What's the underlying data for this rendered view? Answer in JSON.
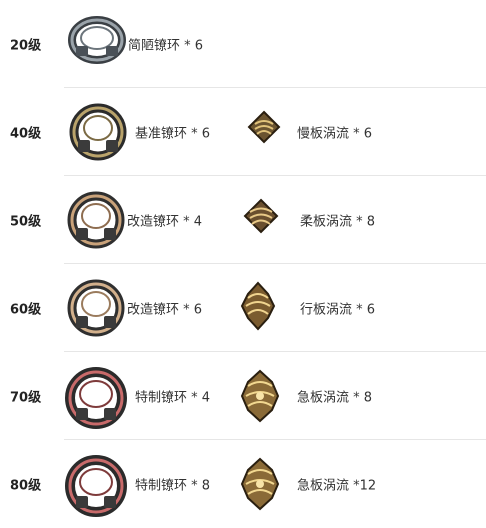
{
  "rows": [
    {
      "level": "20级",
      "ring_label": "简陋镣环 * 6",
      "ring_style": "plain",
      "vortex_label": "",
      "vortex_style": ""
    },
    {
      "level": "40级",
      "ring_label": "基准镣环 * 6",
      "ring_style": "gold",
      "vortex_label": "慢板涡流 * 6",
      "vortex_style": "flat"
    },
    {
      "level": "50级",
      "ring_label": "改造镣环 * 4",
      "ring_style": "copper",
      "vortex_label": "柔板涡流 * 8",
      "vortex_style": "flat"
    },
    {
      "level": "60级",
      "ring_label": "改造镣环 * 6",
      "ring_style": "copper",
      "vortex_label": "行板涡流 * 6",
      "vortex_style": "spiral"
    },
    {
      "level": "70级",
      "ring_label": "特制镣环 * 4",
      "ring_style": "red",
      "vortex_label": "急板涡流 * 8",
      "vortex_style": "ornate"
    },
    {
      "level": "80级",
      "ring_label": "特制镣环 * 8",
      "ring_style": "red",
      "vortex_label": "急板涡流 *12",
      "vortex_style": "ornate"
    }
  ],
  "colors": {
    "divider": "#e6e6e6",
    "level_text": "#222222",
    "item_text": "#333333"
  },
  "icons": {
    "ring": "shackle-ring-icon",
    "vortex": "vortex-material-icon"
  }
}
